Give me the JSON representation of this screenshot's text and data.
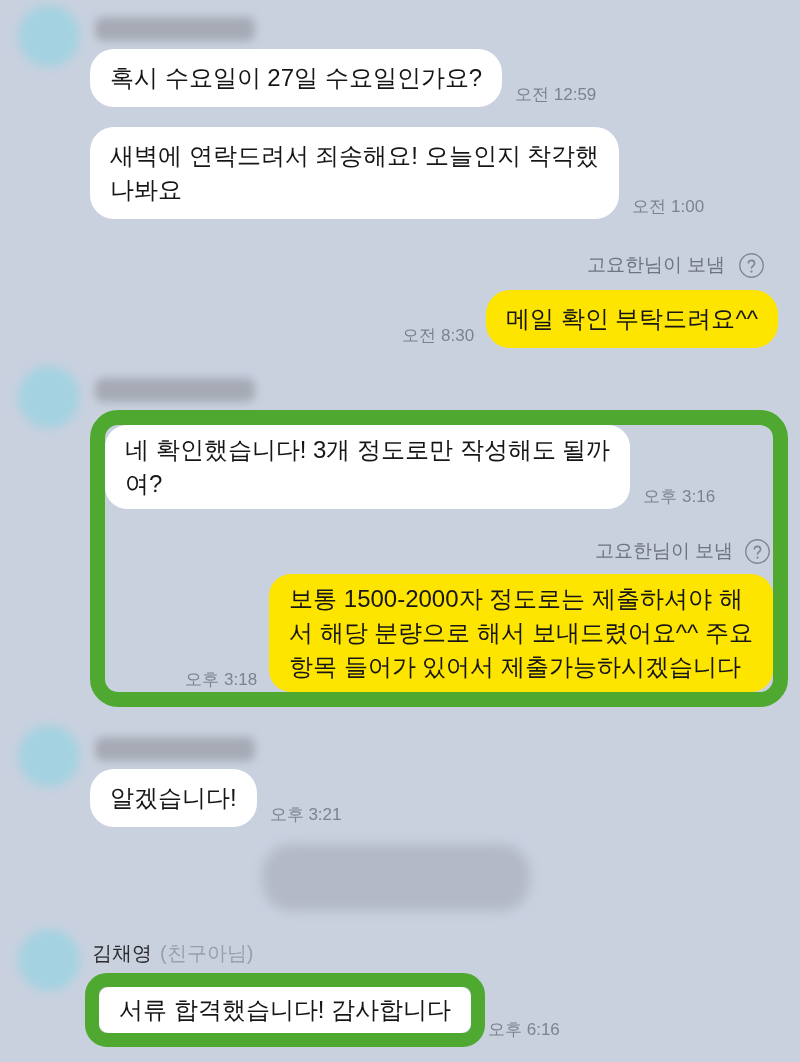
{
  "chat": [
    {
      "kind": "incoming",
      "name_redacted": true,
      "highlighted": false,
      "messages": [
        {
          "lines": [
            "혹시 수요일이 27일 수요일인가요?"
          ],
          "time": "오전 12:59",
          "highlighted": false
        },
        {
          "lines": [
            "새벽에 연락드려서 죄송해요! 오늘인지 착각했",
            "나봐요"
          ],
          "time": "오전 1:00",
          "highlighted": false
        }
      ]
    },
    {
      "kind": "outgoing",
      "sent_label": "고요한님이 보냄",
      "highlighted": false,
      "messages": [
        {
          "lines": [
            "메일 확인 부탁드려요^^"
          ],
          "time": "오전 8:30",
          "highlighted": false
        }
      ]
    },
    {
      "kind": "incoming",
      "name_redacted": true,
      "highlighted": true,
      "messages": [
        {
          "lines": [
            "네 확인했습니다! 3개 정도로만 작성해도 될까",
            "여?"
          ],
          "time": "오후 3:16",
          "highlighted": false
        }
      ]
    },
    {
      "kind": "outgoing",
      "sent_label": "고요한님이 보냄",
      "highlighted": true,
      "messages": [
        {
          "lines": [
            "보통 1500-2000자 정도로는 제출하셔야 해",
            "서 해당 분량으로 해서 보내드렸어요^^ 주요",
            "항목 들어가 있어서 제출가능하시겠습니다"
          ],
          "time": "오후 3:18",
          "highlighted": false
        }
      ]
    },
    {
      "kind": "incoming",
      "name_redacted": true,
      "highlighted": false,
      "messages": [
        {
          "lines": [
            "알겠습니다!"
          ],
          "time": "오후 3:21",
          "highlighted": false
        }
      ]
    },
    {
      "kind": "redacted"
    },
    {
      "kind": "incoming",
      "name_redacted": false,
      "name": "김채영",
      "note": "(친구아님)",
      "highlighted": false,
      "messages": [
        {
          "lines": [
            "서류 합격했습니다! 감사합니다"
          ],
          "time": "오후 6:16",
          "highlighted": true
        }
      ]
    }
  ]
}
